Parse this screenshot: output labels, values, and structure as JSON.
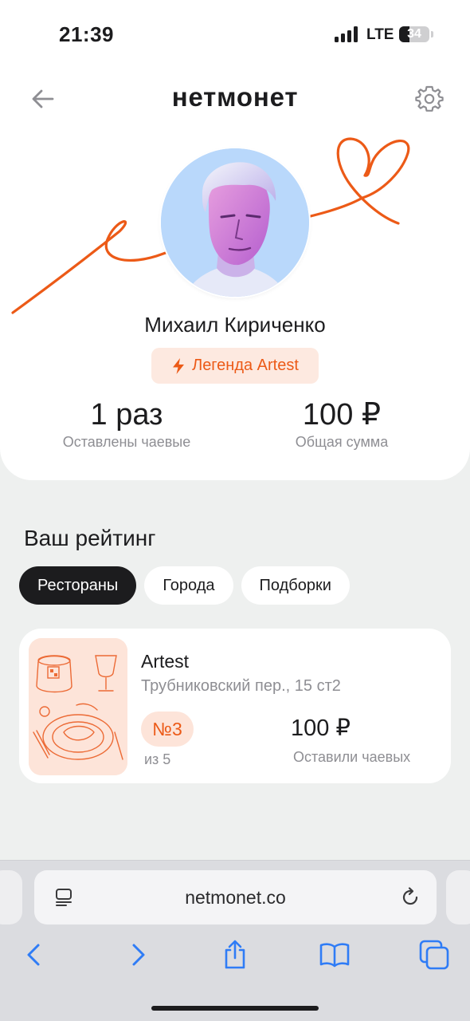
{
  "status_bar": {
    "time": "21:39",
    "network": "LTE",
    "battery": "34",
    "battery_level": 0.34
  },
  "header": {
    "logo": "нетмонет"
  },
  "profile": {
    "name": "Михаил Кириченко",
    "badge": "Легенда Artest",
    "stats": [
      {
        "value": "1 раз",
        "caption": "Оставлены чаевые"
      },
      {
        "value": "100 ₽",
        "caption": "Общая сумма"
      }
    ]
  },
  "rating": {
    "title": "Ваш рейтинг",
    "tabs": [
      {
        "label": "Рестораны",
        "active": true
      },
      {
        "label": "Города",
        "active": false
      },
      {
        "label": "Подборки",
        "active": false
      }
    ],
    "restaurants": [
      {
        "name": "Artest",
        "address": "Трубниковский пер., 15 ст2",
        "rank": "№3",
        "rank_total": "из 5",
        "tips": "100 ₽",
        "tips_caption": "Оставили чаевых"
      }
    ]
  },
  "browser": {
    "url": "netmonet.co"
  },
  "colors": {
    "accent": "#ec5a17",
    "accent_light": "#fde4d9",
    "dark": "#1c1c1e",
    "muted": "#8e8e93"
  }
}
